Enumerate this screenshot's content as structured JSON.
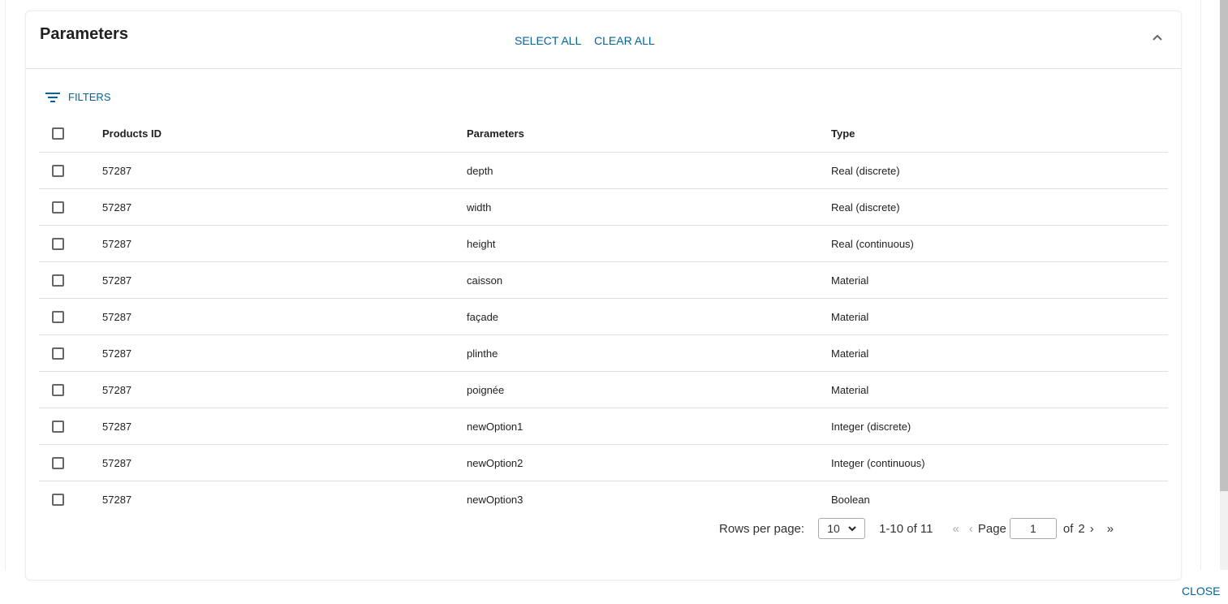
{
  "header": {
    "title": "Parameters",
    "select_all": "SELECT ALL",
    "clear_all": "CLEAR ALL"
  },
  "filters": {
    "label": "FILTERS"
  },
  "table": {
    "columns": [
      "Products ID",
      "Parameters",
      "Type"
    ],
    "rows": [
      [
        "57287",
        "depth",
        "Real (discrete)"
      ],
      [
        "57287",
        "width",
        "Real (discrete)"
      ],
      [
        "57287",
        "height",
        "Real (continuous)"
      ],
      [
        "57287",
        "caisson",
        "Material"
      ],
      [
        "57287",
        "façade",
        "Material"
      ],
      [
        "57287",
        "plinthe",
        "Material"
      ],
      [
        "57287",
        "poignée",
        "Material"
      ],
      [
        "57287",
        "newOption1",
        "Integer (discrete)"
      ],
      [
        "57287",
        "newOption2",
        "Integer (continuous)"
      ],
      [
        "57287",
        "newOption3",
        "Boolean"
      ]
    ]
  },
  "pagination": {
    "rows_per_page_label": "Rows per page:",
    "rows_per_page": "10",
    "range": "1-10 of 11",
    "first": "«",
    "prev": "‹",
    "page_label": "Page",
    "page": "1",
    "of_label": "of",
    "total_pages": "2",
    "next": "›",
    "last": "»"
  },
  "footer": {
    "close": "CLOSE"
  },
  "colors": {
    "accent": "#00639e"
  }
}
